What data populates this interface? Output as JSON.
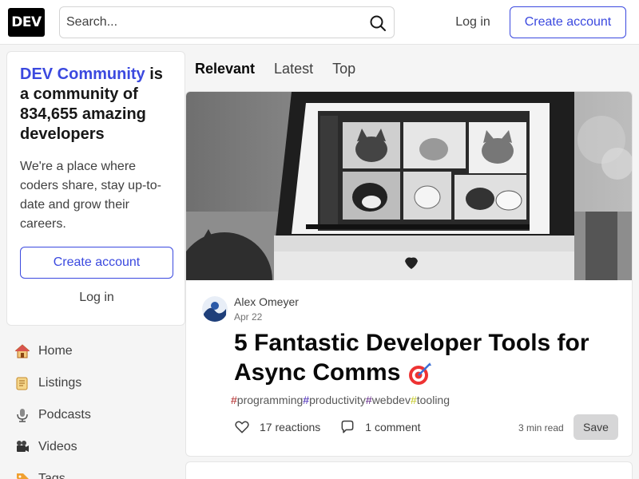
{
  "header": {
    "logo_text": "DEV",
    "search_placeholder": "Search...",
    "login_label": "Log in",
    "create_account_label": "Create account"
  },
  "sidebar": {
    "promo": {
      "brand": "DEV Community",
      "title_rest": " is a community of 834,655 amazing developers",
      "description": "We're a place where coders share, stay up-to-date and grow their careers.",
      "create_account_label": "Create account",
      "login_label": "Log in"
    },
    "nav": [
      {
        "label": "Home",
        "icon": "house-icon"
      },
      {
        "label": "Listings",
        "icon": "scroll-icon"
      },
      {
        "label": "Podcasts",
        "icon": "microphone-icon"
      },
      {
        "label": "Videos",
        "icon": "film-camera-icon"
      },
      {
        "label": "Tags",
        "icon": "tag-icon"
      }
    ]
  },
  "feed": {
    "tabs": [
      {
        "label": "Relevant",
        "active": true
      },
      {
        "label": "Latest",
        "active": false
      },
      {
        "label": "Top",
        "active": false
      }
    ],
    "article": {
      "author": "Alex Omeyer",
      "date": "Apr 22",
      "title": "5 Fantastic Developer Tools for Async Comms",
      "tags": [
        {
          "name": "programming",
          "color": "#ad1f1f"
        },
        {
          "name": "productivity",
          "color": "#3b1ab0"
        },
        {
          "name": "webdev",
          "color": "#571b7e"
        },
        {
          "name": "tooling",
          "color": "#c2c720"
        }
      ],
      "reactions_label": "17 reactions",
      "comments_label": "1 comment",
      "read_time": "3 min read",
      "save_label": "Save"
    }
  },
  "colors": {
    "accent": "#3b49df",
    "background": "#f5f5f5"
  }
}
